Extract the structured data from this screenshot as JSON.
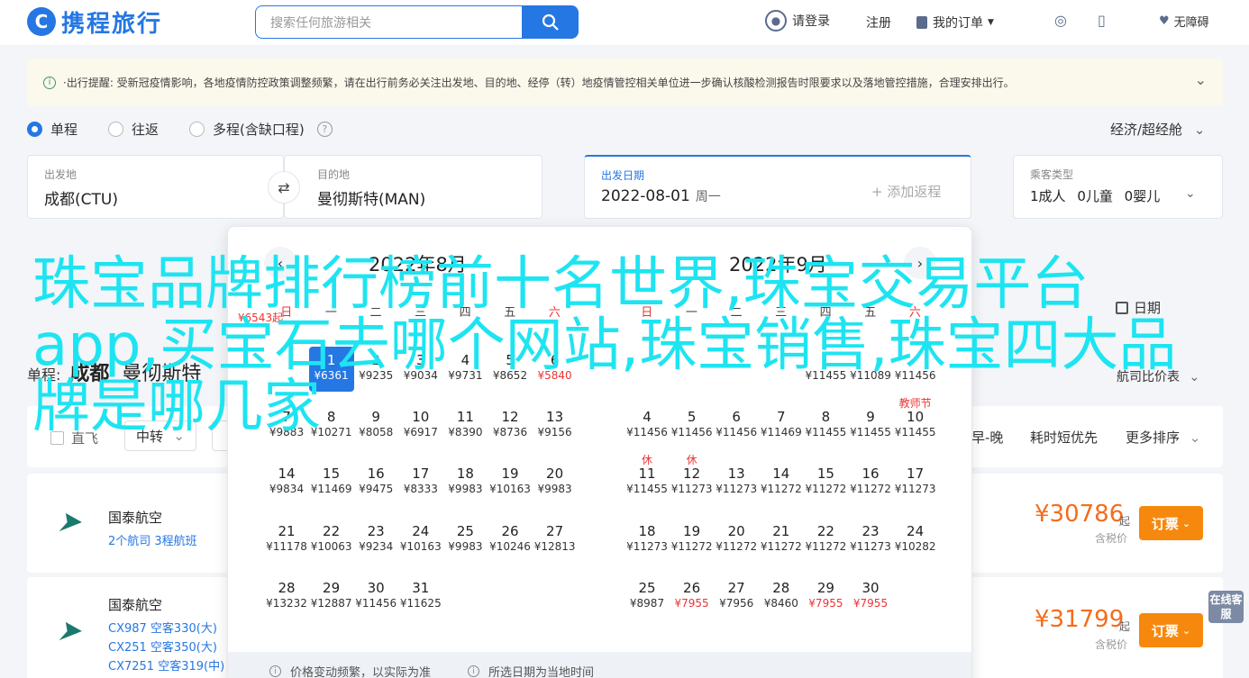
{
  "header": {
    "logo_text": "携程旅行",
    "logo_mark": "C",
    "search_placeholder": "搜索任何旅游相关",
    "login": "请登录",
    "register": "注册",
    "my_orders": "我的订单",
    "barrier_free": "无障碍"
  },
  "notice": {
    "text": "·出行提醒: 受新冠疫情影响，各地疫情防控政策调整频繁，请在出行前务必关注出发地、目的地、经停（转）地疫情管控相关单位进一步确认核酸检测报告时限要求以及落地管控措施，合理安排出行。",
    "icon_glyph": "i"
  },
  "trip_types": [
    {
      "label": "单程",
      "selected": true
    },
    {
      "label": "往返",
      "selected": false
    },
    {
      "label": "多程(含缺口程)",
      "selected": false
    }
  ],
  "cabin": "经济/超经舱",
  "search": {
    "from_label": "出发地",
    "from_value": "成都(CTU)",
    "to_label": "目的地",
    "to_value": "曼彻斯特(MAN)",
    "date_label": "出发日期",
    "date_value": "2022-08-01",
    "weekday": "周一",
    "add_return": "+ 添加返程",
    "pax_label": "乘客类型",
    "pax_adult": "1成人",
    "pax_child": "0儿童",
    "pax_infant": "0婴儿"
  },
  "results": {
    "prefix": "单程:",
    "from_city": "成都",
    "to_city": "曼彻斯特",
    "calendar_link": "日期",
    "trend_link": "航司比价表",
    "direct_only": "直飞",
    "transfer": "中转",
    "sort_times": "早-晚",
    "sort_short": "耗时短优先",
    "sort_more": "更多排序"
  },
  "flights": [
    {
      "airline": "国泰航空",
      "detail": "2个航司  3程航班",
      "price": "¥30786",
      "price_suffix": "起",
      "tax": "含税价",
      "book": "订票"
    },
    {
      "airline": "国泰航空",
      "segments": [
        "CX987 空客330(大)",
        "CX251 空客350(大)",
        "CX7251 空客319(中)"
      ],
      "price": "¥31799",
      "price_suffix": "起",
      "tax": "含税价",
      "book": "订票"
    }
  ],
  "online_service": "在线客服",
  "calendar": {
    "left_month": "2022年8月",
    "right_month": "2022年9月",
    "weekdays": [
      "日",
      "一",
      "二",
      "三",
      "四",
      "五",
      "六"
    ],
    "left_first_row_partial": {
      "price": "¥6543起"
    },
    "aug": [
      {
        "d": "1",
        "p": "¥6361"
      },
      {
        "d": "2",
        "p": "¥9235"
      },
      {
        "d": "3",
        "p": "¥9034"
      },
      {
        "d": "4",
        "p": "¥9731"
      },
      {
        "d": "5",
        "p": "¥8652"
      },
      {
        "d": "6",
        "p": "¥5840"
      },
      {
        "d": "7",
        "p": "¥9883"
      },
      {
        "d": "8",
        "p": "¥10271"
      },
      {
        "d": "9",
        "p": "¥8058"
      },
      {
        "d": "10",
        "p": "¥6917"
      },
      {
        "d": "11",
        "p": "¥8390"
      },
      {
        "d": "12",
        "p": "¥8736"
      },
      {
        "d": "13",
        "p": "¥9156"
      },
      {
        "d": "14",
        "p": "¥9834"
      },
      {
        "d": "15",
        "p": "¥11469"
      },
      {
        "d": "16",
        "p": "¥9475"
      },
      {
        "d": "17",
        "p": "¥8333"
      },
      {
        "d": "18",
        "p": "¥9983"
      },
      {
        "d": "19",
        "p": "¥10163"
      },
      {
        "d": "20",
        "p": "¥9983"
      },
      {
        "d": "21",
        "p": "¥11178"
      },
      {
        "d": "22",
        "p": "¥10063"
      },
      {
        "d": "23",
        "p": "¥9234"
      },
      {
        "d": "24",
        "p": "¥10163"
      },
      {
        "d": "25",
        "p": "¥9983"
      },
      {
        "d": "26",
        "p": "¥10246"
      },
      {
        "d": "27",
        "p": "¥12813"
      },
      {
        "d": "28",
        "p": "¥13232"
      },
      {
        "d": "29",
        "p": "¥12887"
      },
      {
        "d": "30",
        "p": "¥11456"
      },
      {
        "d": "31",
        "p": "¥11625"
      }
    ],
    "sep": [
      {
        "d": "",
        "p": "¥11455"
      },
      {
        "d": "",
        "p": "¥11089"
      },
      {
        "d": "",
        "p": "¥11456"
      },
      {
        "d": "4",
        "p": "¥11456"
      },
      {
        "d": "5",
        "p": "¥11456"
      },
      {
        "d": "6",
        "p": "¥11456"
      },
      {
        "d": "7",
        "p": "¥11469"
      },
      {
        "d": "8",
        "p": "¥11455"
      },
      {
        "d": "9",
        "p": "¥11455"
      },
      {
        "d": "10",
        "p": "¥11455"
      },
      {
        "d": "11",
        "p": "¥11455"
      },
      {
        "d": "12",
        "p": "¥11273"
      },
      {
        "d": "13",
        "p": "¥11273"
      },
      {
        "d": "14",
        "p": "¥11272"
      },
      {
        "d": "15",
        "p": "¥11272"
      },
      {
        "d": "16",
        "p": "¥11272"
      },
      {
        "d": "17",
        "p": "¥11273"
      },
      {
        "d": "18",
        "p": "¥11273"
      },
      {
        "d": "19",
        "p": "¥11272"
      },
      {
        "d": "20",
        "p": "¥11272"
      },
      {
        "d": "21",
        "p": "¥11272"
      },
      {
        "d": "22",
        "p": "¥11272"
      },
      {
        "d": "23",
        "p": "¥11273"
      },
      {
        "d": "24",
        "p": "¥10282"
      },
      {
        "d": "25",
        "p": "¥8987"
      },
      {
        "d": "26",
        "p": "¥7955"
      },
      {
        "d": "27",
        "p": "¥7956"
      },
      {
        "d": "28",
        "p": "¥8460"
      },
      {
        "d": "29",
        "p": "¥7955"
      },
      {
        "d": "30",
        "p": "¥7955"
      }
    ],
    "tag_teachers_day": "教师节",
    "tag_rest": "休",
    "foot_left": "价格变动频繁，以实际为准",
    "foot_right": "所选日期为当地时间"
  },
  "overlay_title": "珠宝品牌排行榜前十名世界,珠宝交易平台app,买宝石去哪个网站,珠宝销售,珠宝四大品牌是哪几家"
}
